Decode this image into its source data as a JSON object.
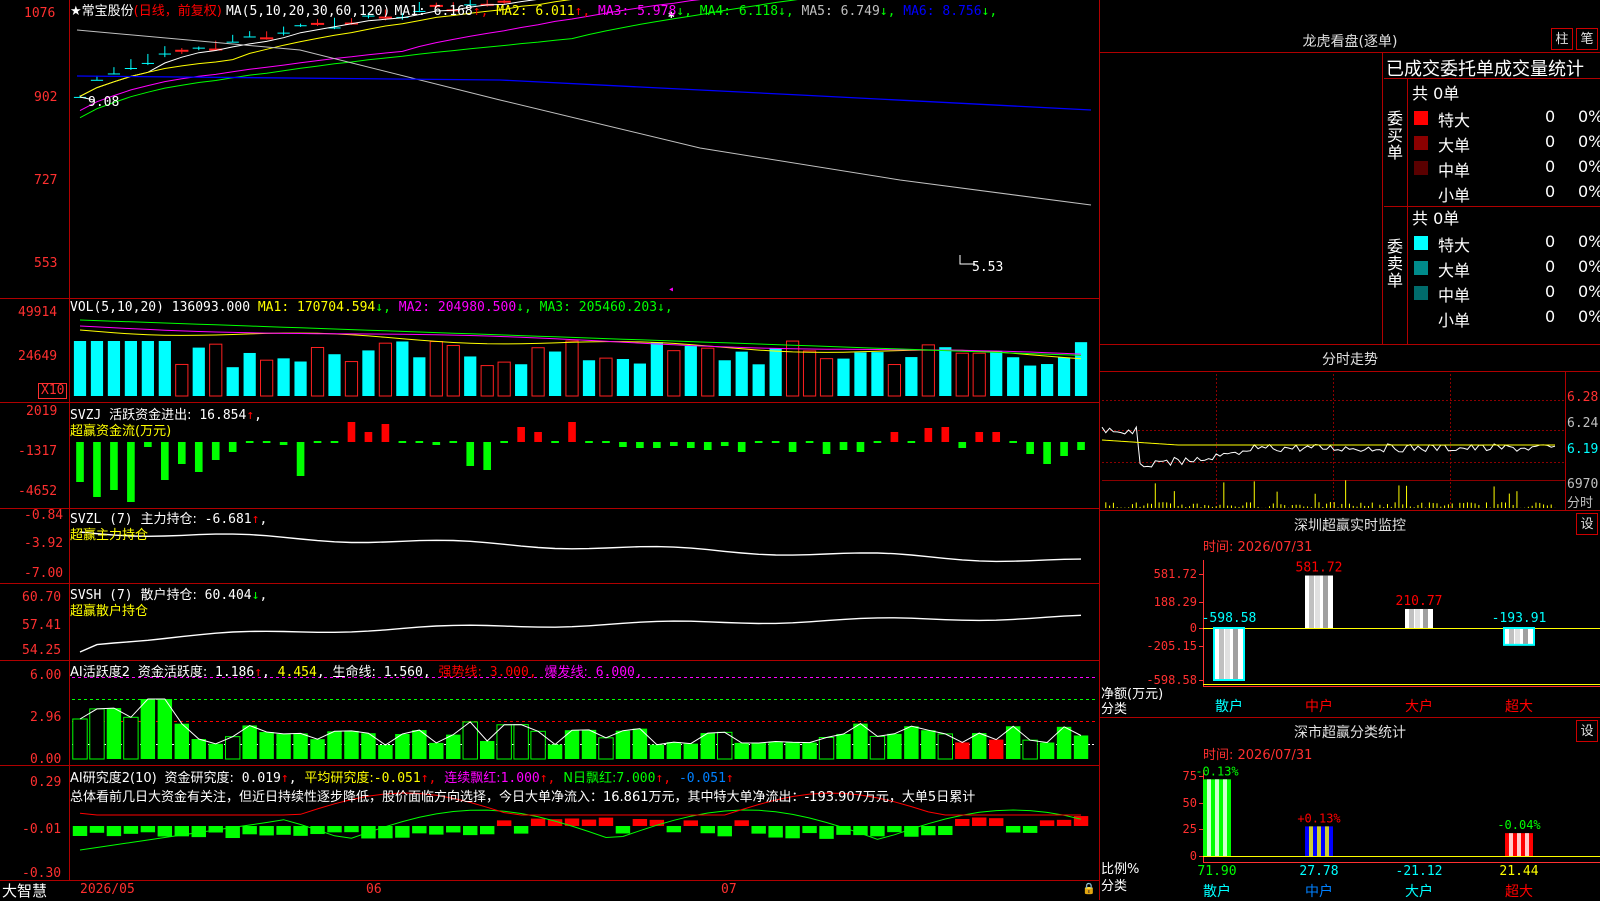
{
  "app": {
    "brand": "大智慧",
    "lock_glyph": "🔒"
  },
  "kline": {
    "star_glyph": "★",
    "stock_name": "常宝股份",
    "period_text": "(日线，前复权)",
    "ma_text": "MA(5,10,20,30,60,120)",
    "ma_items": [
      {
        "label": "MA1:",
        "value": "6.168",
        "arrow": "↑",
        "color": "#ffffff"
      },
      {
        "label": "MA2:",
        "value": "6.011",
        "arrow": "↑",
        "color": "#ffff00"
      },
      {
        "label": "MA3:",
        "value": "5.978",
        "arrow": "↓",
        "color": "#ff00ff"
      },
      {
        "label": "MA4:",
        "value": "6.118",
        "arrow": "↓",
        "color": "#00ff00"
      },
      {
        "label": "MA5:",
        "value": "6.749",
        "arrow": "↓",
        "color": "#c0c0c0"
      },
      {
        "label": "MA6:",
        "value": "8.756",
        "arrow": "↓",
        "color": "#0000ff"
      }
    ],
    "y_ticks": [
      "1076",
      "902",
      "727",
      "553"
    ],
    "high_label": "9.08",
    "low_label": "5.53"
  },
  "vol": {
    "title": "VOL(5,10,20)",
    "value": "136093.000",
    "items": [
      {
        "label": "MA1:",
        "value": "170704.594",
        "arrow": "↓",
        "color": "#ffff00"
      },
      {
        "label": "MA2:",
        "value": "204980.500",
        "arrow": "↓",
        "color": "#ff00ff"
      },
      {
        "label": "MA3:",
        "value": "205460.203",
        "arrow": "↓",
        "color": "#00ff00"
      }
    ],
    "y_ticks": [
      "49914",
      "24649"
    ],
    "unit": "X10"
  },
  "svzj": {
    "title": "SVZJ",
    "label": "活跃资金进出:",
    "value": "16.854",
    "arrow": "↑",
    "subtitle": "超赢资金流(万元)",
    "y_ticks": [
      "2019",
      "-1317",
      "-4652"
    ]
  },
  "svzl": {
    "title": "SVZL (7)",
    "label": "主力持仓:",
    "value": "-6.681",
    "arrow": "↑",
    "subtitle": "超赢主力持仓",
    "y_ticks": [
      "-0.84",
      "-3.92",
      "-7.00"
    ]
  },
  "svsh": {
    "title": "SVSH (7)",
    "label": "散户持仓:",
    "value": "60.404",
    "arrow": "↓",
    "subtitle": "超赢散户持仓",
    "y_ticks": [
      "60.70",
      "57.41",
      "54.25"
    ]
  },
  "ai_active": {
    "title": "AI活跃度2",
    "label": "资金活跃度:",
    "value": "1.186",
    "arrow": "↑",
    "value2": "4.454",
    "life_label": "生命线:",
    "life_value": "1.560,",
    "strong_label": "强势线:",
    "strong_value": "3.000,",
    "burst_label": "爆发线:",
    "burst_value": "6.000,",
    "y_ticks": [
      "6.00",
      "2.96",
      "0.00"
    ]
  },
  "ai_research": {
    "title": "AI研究度2(10)",
    "label": "资金研究度:",
    "value": "0.019",
    "arrow": "↑",
    "avg_label": "平均研究度:",
    "avg_value": "-0.051",
    "streak_label": "连续飘红:",
    "streak_value": "1.000",
    "n_label": "N日飘红:",
    "n_value": "7.000",
    "last_value": "-0.051",
    "summary": "总体看前几日大资金有关注，但近日持续性逐步降低，股价面临方向选择，今日大单净流入：16.861万元，其中特大单净流出：-193.907万元，大单5日累计",
    "y_ticks": [
      "0.29",
      "-0.01",
      "-0.30"
    ]
  },
  "x_axis": {
    "labels": [
      "2026/05",
      "06",
      "07"
    ]
  },
  "lhb": {
    "title": "龙虎看盘(逐单)",
    "btn_bar": "柱",
    "btn_pen": "笔",
    "header": "已成交委托单成交量统计",
    "buy_label": "委买单",
    "sell_label": "委卖单",
    "buy_total": "共 0单",
    "sell_total": "共 0单",
    "buy_rows": [
      {
        "name": "特大",
        "count": "0",
        "pct": "0%",
        "color": "#ff0000"
      },
      {
        "name": "大单",
        "count": "0",
        "pct": "0%",
        "color": "#8b0000"
      },
      {
        "name": "中单",
        "count": "0",
        "pct": "0%",
        "color": "#5a0000"
      },
      {
        "name": "小单",
        "count": "0",
        "pct": "0%",
        "color": ""
      }
    ],
    "sell_rows": [
      {
        "name": "特大",
        "count": "0",
        "pct": "0%",
        "color": "#00ffff"
      },
      {
        "name": "大单",
        "count": "0",
        "pct": "0%",
        "color": "#008b8b"
      },
      {
        "name": "中单",
        "count": "0",
        "pct": "0%",
        "color": "#006b6b"
      },
      {
        "name": "小单",
        "count": "0",
        "pct": "0%",
        "color": ""
      }
    ]
  },
  "fenshi": {
    "title": "分时走势",
    "y_ticks": [
      "6.28",
      "6.24",
      "6.19"
    ],
    "vol_tick": "6970",
    "vol_label": "分时"
  },
  "monitor": {
    "title": "深圳超赢实时监控",
    "btn": "设",
    "time": "时间: 2026/07/31",
    "y_ticks": [
      "581.72",
      "188.29",
      "0",
      "-205.15",
      "-598.58"
    ],
    "axis_label_1": "净额(万元)",
    "axis_label_2": "分类",
    "categories": [
      "散户",
      "中户",
      "大户",
      "超大"
    ],
    "values": [
      -598.58,
      581.72,
      210.77,
      -193.91
    ],
    "value_labels": [
      "-598.58",
      "581.72",
      "210.77",
      "-193.91"
    ]
  },
  "classify": {
    "title": "深市超赢分类统计",
    "btn": "设",
    "time": "时间: 2026/07/31",
    "y_ticks": [
      "75",
      "50",
      "25",
      "0"
    ],
    "axis_label_1": "比例%",
    "axis_label_2": "分类",
    "categories": [
      "散户",
      "中户",
      "大户",
      "超大"
    ],
    "values": [
      71.9,
      27.78,
      -21.12,
      21.44
    ],
    "value_labels": [
      "71.90",
      "27.78",
      "-21.12",
      "21.44"
    ],
    "delta_labels": [
      "-0.13%",
      "+0.13%",
      "",
      "-0.04%"
    ]
  }
}
